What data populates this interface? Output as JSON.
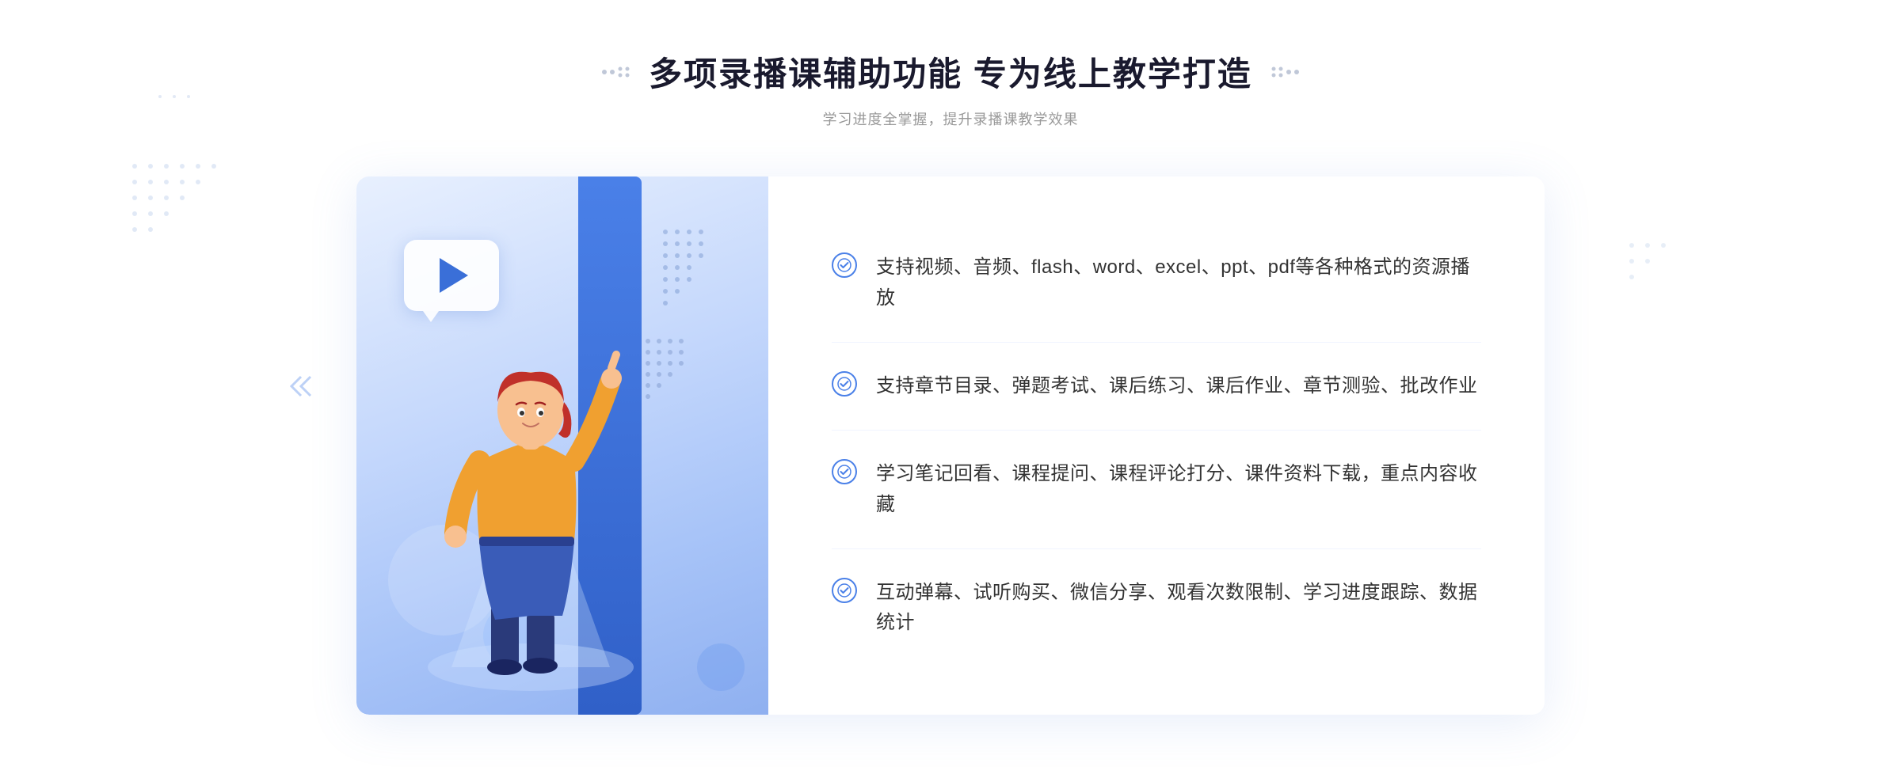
{
  "header": {
    "title": "多项录播课辅助功能 专为线上教学打造",
    "subtitle": "学习进度全掌握，提升录播课教学效果",
    "decoration_dots": "···"
  },
  "features": [
    {
      "id": 1,
      "text": "支持视频、音频、flash、word、excel、ppt、pdf等各种格式的资源播放"
    },
    {
      "id": 2,
      "text": "支持章节目录、弹题考试、课后练习、课后作业、章节测验、批改作业"
    },
    {
      "id": 3,
      "text": "学习笔记回看、课程提问、课程评论打分、课件资料下载，重点内容收藏"
    },
    {
      "id": 4,
      "text": "互动弹幕、试听购买、微信分享、观看次数限制、学习进度跟踪、数据统计"
    }
  ],
  "colors": {
    "primary_blue": "#4a80e8",
    "light_blue": "#3060c8",
    "text_dark": "#1a1a2e",
    "text_medium": "#333333",
    "text_light": "#999999",
    "bg_gradient_start": "#e8f0fe",
    "bg_gradient_end": "#8fb0f0"
  }
}
